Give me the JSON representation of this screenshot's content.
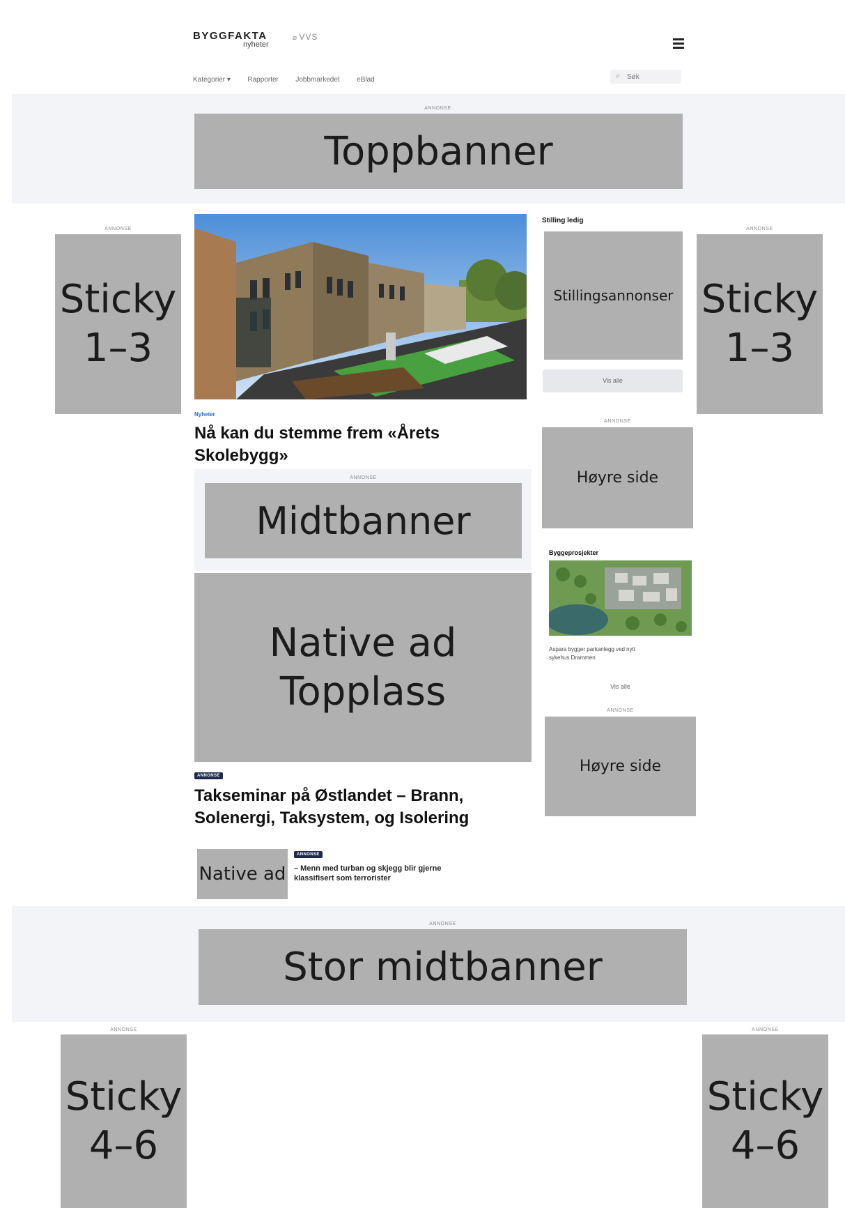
{
  "header": {
    "brand_line1": "BYGGFAKTA",
    "brand_line2": "nyheter",
    "partner_prefix": "⌀",
    "partner": "VVS",
    "nav": [
      "Kategorier ▾",
      "Rapporter",
      "Jobbmarkedet",
      "eBlad"
    ],
    "search_placeholder": "Søk"
  },
  "ad_label": "ANNONSE",
  "ads": {
    "top_banner": "Toppbanner",
    "sticky_top": [
      "Sticky",
      "1–3"
    ],
    "mid_banner": "Midtbanner",
    "native_top": [
      "Native ad",
      "Topplass"
    ],
    "native_small": "Native ad",
    "stillings": "Stillingsannonser",
    "right_side": "Høyre side",
    "big_mid_banner": "Stor midtbanner",
    "sticky_bottom": [
      "Sticky",
      "4–6"
    ]
  },
  "main_article": {
    "category": "Nyheter",
    "title_line1": "Nå kan du stemme frem «Årets",
    "title_line2": "Skolebygg»"
  },
  "sponsored_article": {
    "kicker": "ANNONSE",
    "title_line1": "Takseminar på Østlandet – Brann,",
    "title_line2": "Solenergi, Taksystem, og Isolering"
  },
  "small_sponsored": {
    "kicker": "ANNONSE",
    "title_line1": "– Menn med turban og skjegg blir gjerne",
    "title_line2": "klassifisert som terrorister"
  },
  "sidebar": {
    "jobs_heading": "Stilling ledig",
    "jobs_button": "Vis alle",
    "projects_heading": "Byggeprosjekter",
    "project_text_line1": "Aspara bygger parkanlegg ved nytt",
    "project_text_line2": "sykehus Drammen",
    "projects_button": "Vis alle"
  },
  "colors": {
    "ad_gray": "#b0b0b0",
    "band_bg": "#f3f4f7",
    "kicker_navy": "#1f2b4b",
    "category_blue": "#1f6fd1"
  }
}
